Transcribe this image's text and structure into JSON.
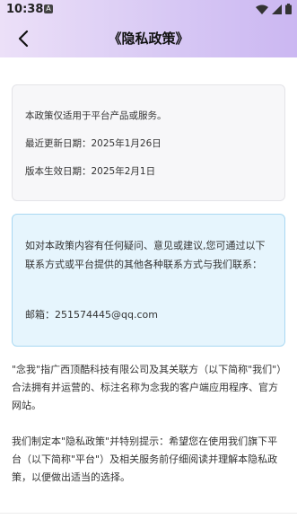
{
  "status_bar": {
    "time": "10:38",
    "app_icon": "A",
    "icons": [
      "wifi-icon",
      "signal-icon",
      "battery-icon"
    ]
  },
  "header": {
    "title": "《隐私政策》",
    "back_icon": "chevron-left-icon"
  },
  "info_card": {
    "applies_to": "本政策仅适用于平台产品或服务。",
    "last_updated": "最近更新日期：2025年1月26日",
    "effective_date": "版本生效日期：2025年2月1日"
  },
  "contact_card": {
    "text": "如对本政策内容有任何疑问、意见或建议,您可通过以下联系方式或平台提供的其他各种联系方式与我们联系：",
    "email": "邮箱：251574445@qq.com"
  },
  "body": {
    "paragraph_1": "\"念我\"指广西顶酷科技有限公司及其关联方（以下简称\"我们\"）合法拥有并运营的、标注名称为念我的客户端应用程序、官方网站。",
    "paragraph_2": "我们制定本\"隐私政策\"并特别提示：希望您在使用我们旗下平台（以下简称\"平台\"）及相关服务前仔细阅读并理解本隐私政策，以便做出适当的选择。"
  },
  "colors": {
    "header_gradient_start": "#ece0f8",
    "header_gradient_end": "#cbb7f2",
    "info_card_bg": "#f7f7f9",
    "contact_card_bg": "#e6f5fd",
    "contact_card_border": "#a9d8f2"
  }
}
